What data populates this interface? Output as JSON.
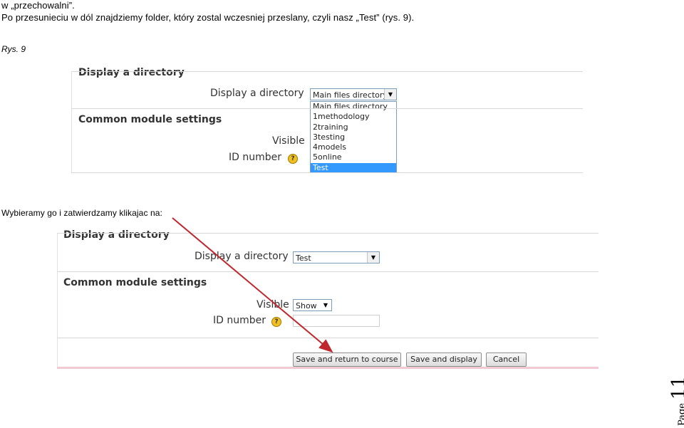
{
  "text": {
    "line1": "w „przechowalni”.",
    "line2": "Po przesunieciu w dól znajdziemy folder, który zostal wczesniej przeslany, czyli nasz „Test” (rys. 9).",
    "caption": "Rys. 9",
    "line3": "Wybieramy go i zatwierdzamy klikajac na:"
  },
  "shot1": {
    "section1": "Display a directory",
    "label_dir": "Display a directory",
    "select_value": "Main files directory",
    "options": [
      "Main files directory",
      "1methodology",
      "2training",
      "3testing",
      "4models",
      "5online",
      "Test"
    ],
    "selected_option": "Test",
    "section2": "Common module settings",
    "label_visible": "Visible",
    "label_id": "ID number",
    "help_glyph": "?"
  },
  "shot2": {
    "section1": "Display a directory",
    "label_dir": "Display a directory",
    "select_value": "Test",
    "section2": "Common module settings",
    "label_visible": "Visible",
    "visible_value": "Show",
    "label_id": "ID number",
    "help_glyph": "?",
    "buttons": {
      "save_return": "Save and return to course",
      "save_display": "Save and display",
      "cancel": "Cancel"
    }
  },
  "footer": {
    "page_word": "Page",
    "page_number": "11"
  },
  "colors": {
    "arrow": "#c0272d",
    "selection": "#3399ff",
    "accent_line": "#f2c9d2"
  },
  "icons": {
    "dropdown_arrow": "triangle-down",
    "help": "question-circle",
    "annotation": "red-arrow"
  }
}
